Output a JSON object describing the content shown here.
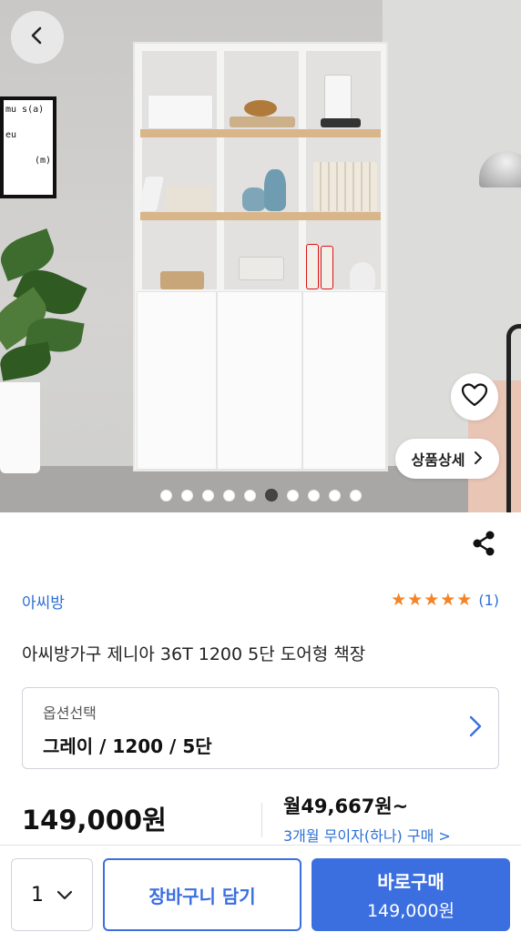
{
  "hero": {
    "poster_lines": [
      "mu s(a)",
      "eu",
      "(m)"
    ],
    "detail_button": "상품상세",
    "carousel": {
      "count": 10,
      "active_index": 5
    }
  },
  "product": {
    "brand": "아씨방",
    "rating_stars": 5,
    "review_count": "(1)",
    "title": "아씨방가구 제니아 36T 1200 5단 도어형 책장",
    "option": {
      "label": "옵션선택",
      "value": "그레이 / 1200 / 5단"
    },
    "price": "149,000원",
    "monthly": "월49,667원~",
    "installment": "3개월 무이자(하나) 구매 >"
  },
  "bottom": {
    "quantity": "1",
    "cart_label": "장바구니 담기",
    "buy_label": "바로구매",
    "buy_price": "149,000원"
  },
  "colors": {
    "accent": "#3b6fe0",
    "link": "#2b6fd6",
    "star": "#f58426"
  },
  "icons": [
    "back-arrow-icon",
    "heart-icon",
    "chevron-right-icon",
    "share-icon",
    "star-icon",
    "chevron-down-icon"
  ]
}
